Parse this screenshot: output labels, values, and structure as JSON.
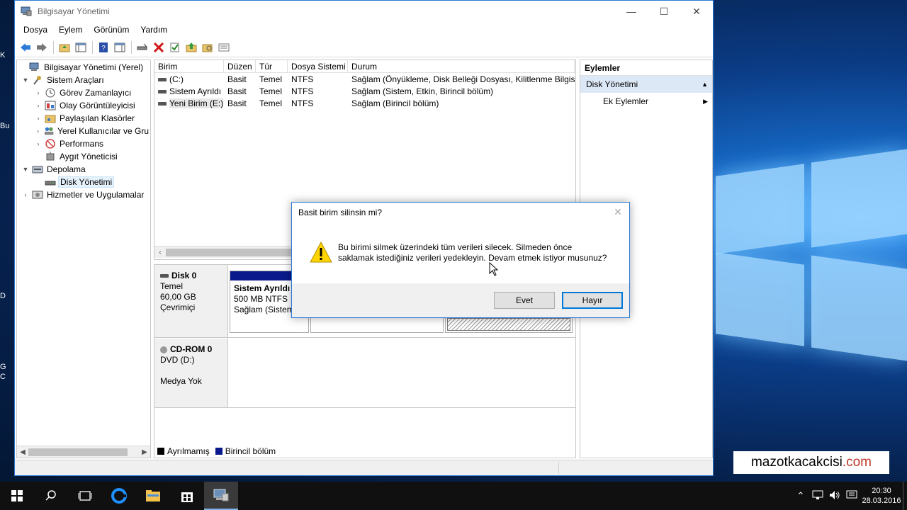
{
  "window": {
    "title": "Bilgisayar Yönetimi",
    "minimize": "—",
    "maximize": "☐",
    "close": "✕"
  },
  "menu": [
    "Dosya",
    "Eylem",
    "Görünüm",
    "Yardım"
  ],
  "tree": {
    "items": [
      {
        "label": "Bilgisayar Yönetimi (Yerel)",
        "level": 0,
        "expander": ""
      },
      {
        "label": "Sistem Araçları",
        "level": 1,
        "expander": "▼"
      },
      {
        "label": "Görev Zamanlayıcı",
        "level": 2,
        "expander": "›"
      },
      {
        "label": "Olay Görüntüleyicisi",
        "level": 2,
        "expander": "›"
      },
      {
        "label": "Paylaşılan Klasörler",
        "level": 2,
        "expander": "›"
      },
      {
        "label": "Yerel Kullanıcılar ve Gru",
        "level": 2,
        "expander": "›"
      },
      {
        "label": "Performans",
        "level": 2,
        "expander": "›"
      },
      {
        "label": "Aygıt Yöneticisi",
        "level": 2,
        "expander": ""
      },
      {
        "label": "Depolama",
        "level": 1,
        "expander": "▼"
      },
      {
        "label": "Disk Yönetimi",
        "level": 2,
        "expander": ""
      },
      {
        "label": "Hizmetler ve Uygulamalar",
        "level": 1,
        "expander": "›"
      }
    ]
  },
  "volumes": {
    "columns": [
      "Birim",
      "Düzen",
      "Tür",
      "Dosya Sistemi",
      "Durum"
    ],
    "rows": [
      [
        "(C:)",
        "Basit",
        "Temel",
        "NTFS",
        "Sağlam (Önyükleme, Disk Belleği Dosyası, Kilitlenme Bilgisi,"
      ],
      [
        "Sistem Ayrıldı",
        "Basit",
        "Temel",
        "NTFS",
        "Sağlam (Sistem, Etkin, Birincil bölüm)"
      ],
      [
        "Yeni Birim (E:)",
        "Basit",
        "Temel",
        "NTFS",
        "Sağlam (Birincil bölüm)"
      ]
    ]
  },
  "disks": [
    {
      "name": "Disk 0",
      "type": "Temel",
      "size": "60,00 GB",
      "state": "Çevrimiçi"
    },
    {
      "name": "CD-ROM 0",
      "type": "DVD (D:)",
      "size": "",
      "state": "Medya Yok"
    }
  ],
  "partition": {
    "name": "Sistem Ayrıldı",
    "size": "500 MB NTFS",
    "status": "Sağlam (Sistem,"
  },
  "legend": [
    {
      "label": "Ayrılmamış",
      "color": "#000000"
    },
    {
      "label": "Birincil bölüm",
      "color": "#0a1a8c"
    }
  ],
  "actions": {
    "header": "Eylemler",
    "selected": "Disk Yönetimi",
    "sub": "Ek Eylemler"
  },
  "dialog": {
    "title": "Basit birim silinsin mi?",
    "line1": "Bu birimi silmek üzerindeki tüm verileri silecek. Silmeden önce",
    "line2": "saklamak istediğiniz verileri yedekleyin. Devam etmek istiyor musunuz?",
    "yes": "Evet",
    "no": "Hayır",
    "close": "✕"
  },
  "desktop": {
    "icon_labels": [
      "K",
      "Bu",
      "D",
      "G",
      "C"
    ],
    "watermark_main": "mazotkacakcisi",
    "watermark_domain": ".com"
  },
  "taskbar": {
    "time": "20:30",
    "date": "28.03.2016"
  },
  "colors": {
    "accent": "#2b79d6",
    "primary_partition": "#0a1a8c",
    "action_selected": "#dce8f6"
  }
}
